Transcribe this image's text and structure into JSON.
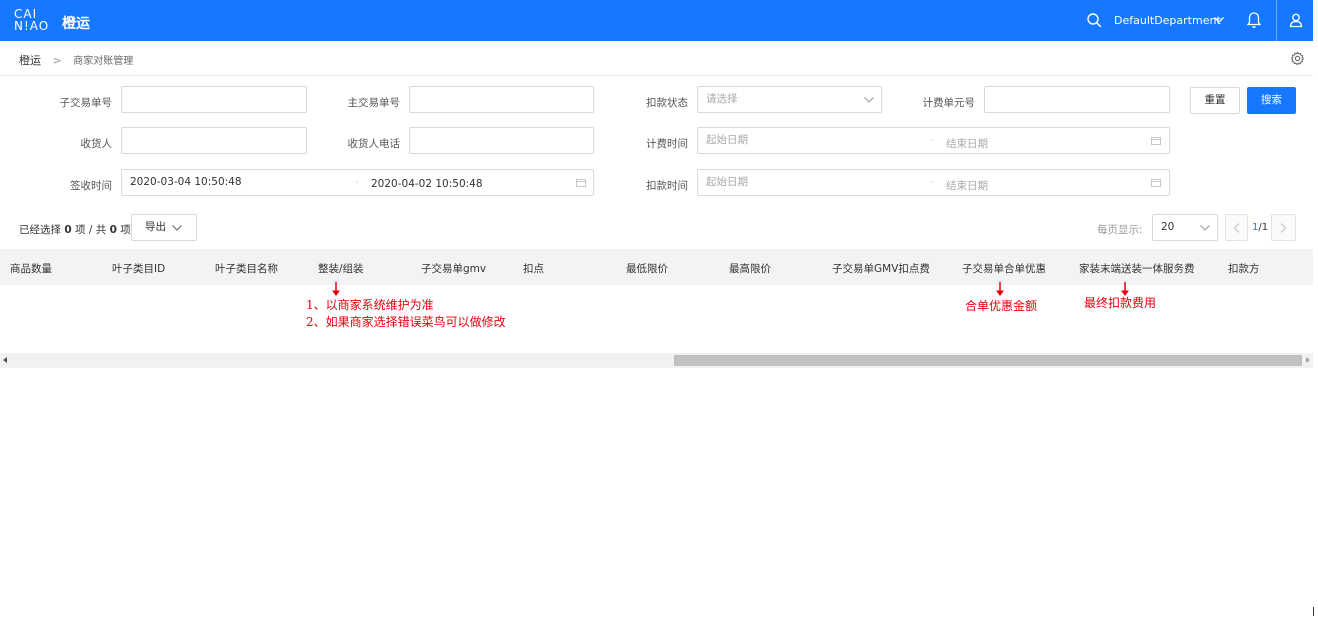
{
  "header": {
    "logo_line1": "CAI",
    "logo_line2": "N!AO",
    "app_title": "橙运",
    "department": "DefaultDepartment",
    "icons": [
      "search-icon",
      "chevron-down-icon",
      "bell-icon",
      "user-icon"
    ]
  },
  "breadcrumb": {
    "root": "橙运",
    "separator": ">",
    "current": "商家对账管理"
  },
  "form": {
    "sub_order_no": {
      "label": "子交易单号",
      "value": ""
    },
    "main_order_no": {
      "label": "主交易单号",
      "value": ""
    },
    "deduct_status": {
      "label": "扣款状态",
      "placeholder": "请选择"
    },
    "billing_unit_no": {
      "label": "计费单元号",
      "value": ""
    },
    "receiver": {
      "label": "收货人",
      "value": ""
    },
    "receiver_phone": {
      "label": "收货人电话",
      "value": ""
    },
    "billing_time": {
      "label": "计费时间",
      "start_placeholder": "起始日期",
      "end_placeholder": "结束日期"
    },
    "sign_time": {
      "label": "签收时间",
      "start": "2020-03-04 10:50:48",
      "end": "2020-04-02 10:50:48"
    },
    "deduct_time": {
      "label": "扣款时间",
      "start_placeholder": "起始日期",
      "end_placeholder": "结束日期"
    },
    "range_dash": "-",
    "reset_label": "重置",
    "search_label": "搜索"
  },
  "toolbar": {
    "selected_prefix": "已经选择",
    "selected_count": "0",
    "selected_unit": "项 / 共",
    "total_count": "0",
    "total_unit": "项",
    "export_label": "导出",
    "per_page_label": "每页显示:",
    "per_page_value": "20",
    "page_current": "1",
    "page_total": "/1"
  },
  "table": {
    "columns": [
      "商品数量",
      "叶子类目ID",
      "叶子类目名称",
      "整装/组装",
      "子交易单gmv",
      "扣点",
      "最低限价",
      "最高限价",
      "子交易单GMV扣点费",
      "子交易单合单优惠",
      "家装末端送装一体服务费",
      "扣款方"
    ]
  },
  "annotations": {
    "assembly_note_1": "1、以商家系统维护为准",
    "assembly_note_2": "2、如果商家选择错误菜鸟可以做修改",
    "merge_discount_note": "合单优惠金额",
    "final_fee_note": "最终扣款费用"
  },
  "colors": {
    "primary": "#1677ff",
    "annotation_red": "#e8000b",
    "table_header_bg": "#f2f3f5"
  }
}
